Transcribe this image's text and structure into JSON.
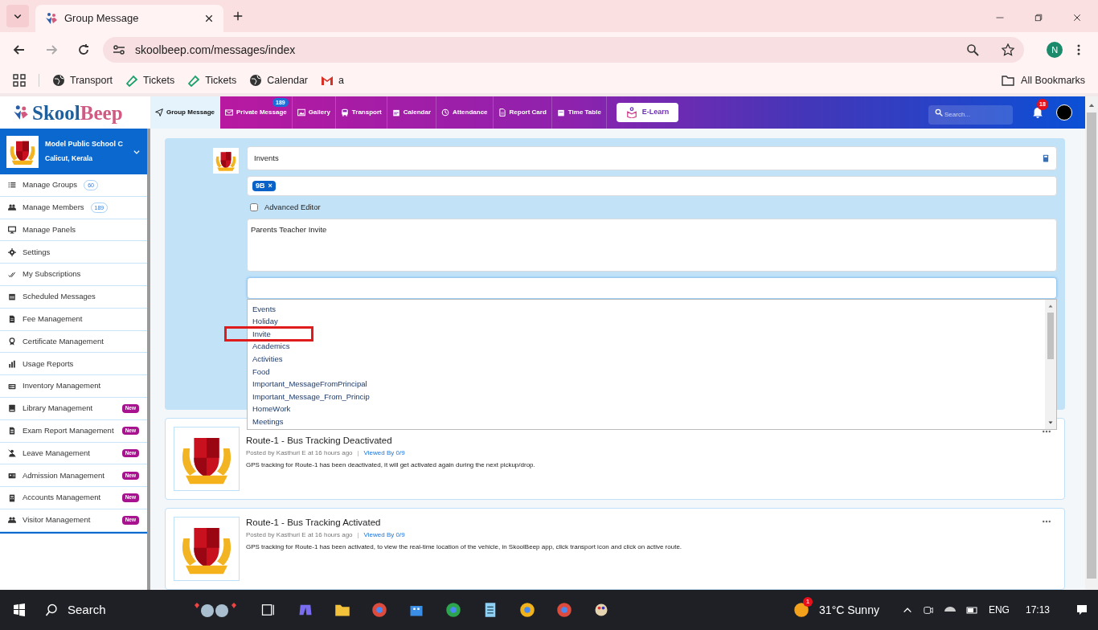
{
  "browser": {
    "tab_title": "Group Message",
    "url": "skoolbeep.com/messages/index",
    "profile": "N",
    "bookmarks": [
      "Transport",
      "Tickets",
      "Tickets",
      "Calendar",
      "a"
    ],
    "all_bookmarks": "All Bookmarks"
  },
  "app": {
    "logo": {
      "part_1": "Skool",
      "part_2": "Beep"
    },
    "nav": [
      {
        "label": "Group Message",
        "selected": true
      },
      {
        "label": "Private Message",
        "selected": false,
        "badge": "189"
      },
      {
        "label": "Gallery",
        "selected": false
      },
      {
        "label": "Transport",
        "selected": false
      },
      {
        "label": "Calendar",
        "selected": false
      },
      {
        "label": "Attendance",
        "selected": false
      },
      {
        "label": "Report Card",
        "selected": false
      },
      {
        "label": "Time Table",
        "selected": false
      }
    ],
    "elearn": "E-Learn",
    "search": {
      "placeholder": "Search..."
    },
    "notifications": "18"
  },
  "school": {
    "name": "Model Public School C",
    "location": "Calicut, Kerala"
  },
  "sidebar": {
    "items": [
      {
        "label": "Manage Groups",
        "count": "60"
      },
      {
        "label": "Manage Members",
        "count": "189"
      },
      {
        "label": "Manage Panels"
      },
      {
        "label": "Settings"
      },
      {
        "label": "My Subscriptions"
      },
      {
        "label": "Scheduled Messages"
      },
      {
        "label": "Fee Management"
      },
      {
        "label": "Certificate Management"
      },
      {
        "label": "Usage Reports"
      },
      {
        "label": "Inventory Management"
      },
      {
        "label": "Library Management",
        "tag": "New"
      },
      {
        "label": "Exam Report Management",
        "tag": "New"
      },
      {
        "label": "Leave Management",
        "tag": "New"
      },
      {
        "label": "Admission Management",
        "tag": "New"
      },
      {
        "label": "Accounts Management",
        "tag": "New"
      },
      {
        "label": "Visitor Management",
        "tag": "New"
      }
    ]
  },
  "compose": {
    "subject": "Invents",
    "recipients": [
      {
        "label": "9B",
        "remove": "×"
      }
    ],
    "advanced_editor": {
      "label": "Advanced Editor",
      "checked": false
    },
    "message": "Parents Teacher Invite",
    "category_options": [
      {
        "label": "Events",
        "highlighted": false
      },
      {
        "label": "Holiday",
        "highlighted": false
      },
      {
        "label": "Invite",
        "highlighted": true
      },
      {
        "label": "Academics",
        "highlighted": false
      },
      {
        "label": "Activities",
        "highlighted": false
      },
      {
        "label": "Food",
        "highlighted": false
      },
      {
        "label": "Important_MessageFromPrincipal",
        "highlighted": false
      },
      {
        "label": "Important_Message_From_Princip",
        "highlighted": false
      },
      {
        "label": "HomeWork",
        "highlighted": false
      },
      {
        "label": "Meetings",
        "highlighted": false
      }
    ]
  },
  "posts": [
    {
      "title": "Route-1 - Bus Tracking Deactivated",
      "meta": "Posted by Kasthuri E at 16 hours ago",
      "separator": "|",
      "viewed": "Viewed By 0/9",
      "body": "GPS tracking for Route-1 has been deactivated, it will get activated again during the next pickup/drop."
    },
    {
      "title": "Route-1 - Bus Tracking Activated",
      "meta": "Posted by Kasthuri E at 16 hours ago",
      "separator": "|",
      "viewed": "Viewed By 0/9",
      "body": "GPS tracking for Route-1 has been activated, to view the real-time location of the vehicle, in SkoolBeep app, click transport icon and click on active route."
    }
  ],
  "taskbar": {
    "search": "Search",
    "weather": "31°C Sunny",
    "weather_badge": "1",
    "language": "ENG",
    "time": "17:13"
  }
}
